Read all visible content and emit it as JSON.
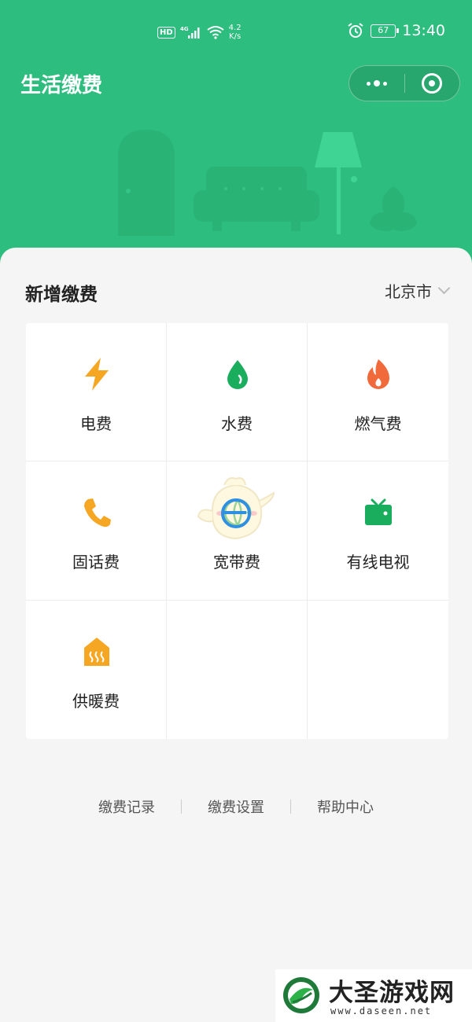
{
  "status_bar": {
    "hd_badge": "HD",
    "network": "4G",
    "speed_value": "4.2",
    "speed_unit": "K/s",
    "battery": "67",
    "time": "13:40"
  },
  "header": {
    "title": "生活缴费"
  },
  "section": {
    "title": "新增缴费",
    "city": "北京市"
  },
  "services": [
    {
      "label": "电费",
      "icon": "lightning-icon",
      "color": "#f5a623"
    },
    {
      "label": "水费",
      "icon": "water-drop-icon",
      "color": "#1aad5e"
    },
    {
      "label": "燃气费",
      "icon": "flame-icon",
      "color": "#f06a3c"
    },
    {
      "label": "固话费",
      "icon": "phone-icon",
      "color": "#f5a623"
    },
    {
      "label": "宽带费",
      "icon": "globe-icon",
      "color": "#1aad5e"
    },
    {
      "label": "有线电视",
      "icon": "tv-icon",
      "color": "#1aad5e"
    },
    {
      "label": "供暖费",
      "icon": "heating-icon",
      "color": "#f5a623"
    }
  ],
  "footer": {
    "records": "缴费记录",
    "settings": "缴费设置",
    "help": "帮助中心"
  },
  "watermark": {
    "title": "大圣游戏网",
    "url": "www.daseen.net"
  },
  "colors": {
    "brand": "#2dbd7e",
    "page_bg": "#f5f5f5"
  }
}
